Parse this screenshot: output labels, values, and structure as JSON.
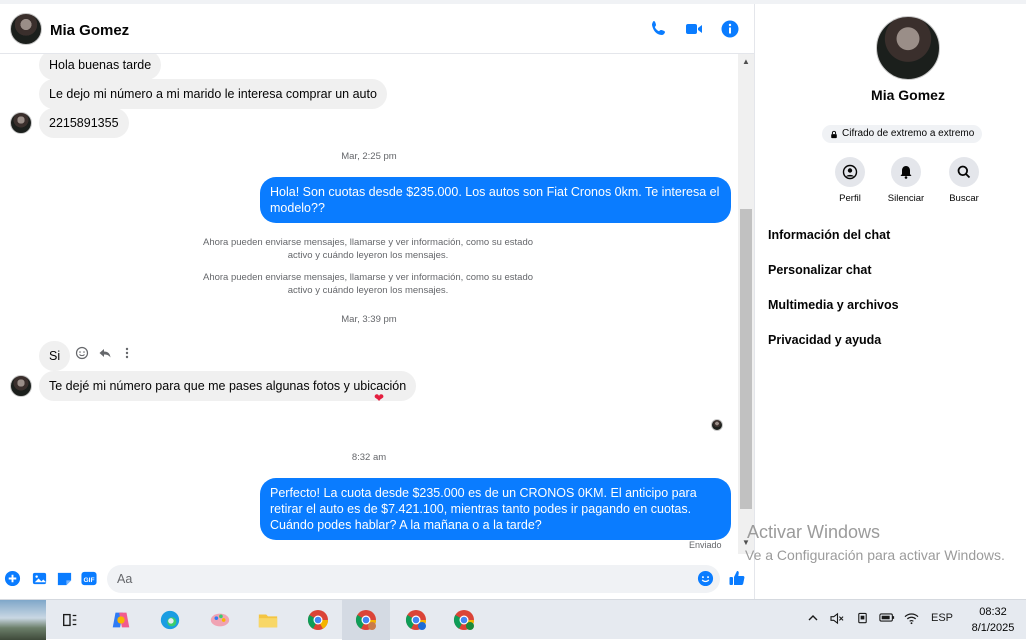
{
  "header": {
    "contact_name": "Mia Gomez"
  },
  "messages": {
    "in1": "Hola buenas tarde",
    "in2": "Le dejo mi número a mi marido le interesa comprar un auto",
    "in3": "2215891355",
    "ts1": "Mar, 2:25 pm",
    "out1": "Hola! Son cuotas desde $235.000. Los autos son Fiat Cronos 0km. Te interesa el modelo??",
    "sys1": "Ahora pueden enviarse mensajes, llamarse y ver información, como su estado activo y cuándo leyeron los mensajes.",
    "sys2": "Ahora pueden enviarse mensajes, llamarse y ver información, como su estado activo y cuándo leyeron los mensajes.",
    "ts2": "Mar, 3:39 pm",
    "in4": "Si",
    "in5": "Te dejé mi número para que me pases algunas fotos y ubicación",
    "reaction": "❤",
    "ts3": "8:32 am",
    "out2": "Perfecto! La cuota desde $235.000 es de un CRONOS 0KM. El anticipo para retirar el auto es de $7.421.100, mientras tanto podes ir pagando en cuotas. Cuándo podes hablar? A la mañana o a la tarde?",
    "status": "Enviado"
  },
  "composer": {
    "placeholder": "Aa"
  },
  "info": {
    "name": "Mia Gomez",
    "e2e": "Cifrado de extremo a extremo",
    "actions": [
      {
        "label": "Perfil"
      },
      {
        "label": "Silenciar"
      },
      {
        "label": "Buscar"
      }
    ],
    "menu": [
      "Información del chat",
      "Personalizar chat",
      "Multimedia y archivos",
      "Privacidad y ayuda"
    ]
  },
  "watermark": {
    "line1": "Activar Windows",
    "line2": "Ve a Configuración para activar Windows."
  },
  "taskbar": {
    "lang": "ESP",
    "time": "08:32",
    "date": "8/1/2025"
  },
  "colors": {
    "accent": "#0a7cff",
    "incoming": "#f0f0f0"
  }
}
